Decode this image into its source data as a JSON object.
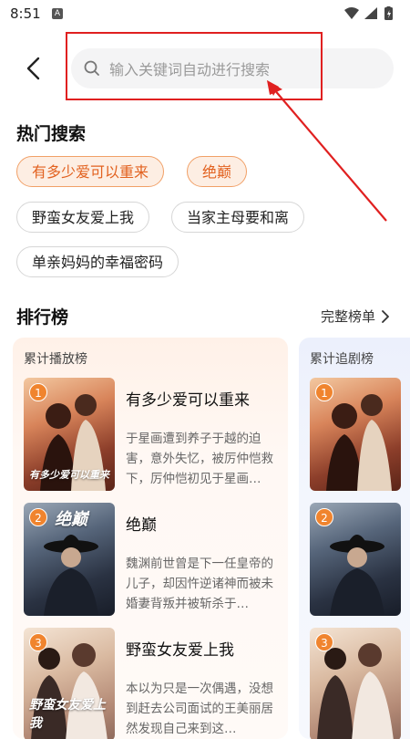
{
  "status_bar": {
    "time": "8:51",
    "badge": "A"
  },
  "search": {
    "placeholder": "输入关键词自动进行搜索"
  },
  "hot_search": {
    "title": "热门搜索",
    "tags": [
      {
        "label": "有多少爱可以重来",
        "hot": true
      },
      {
        "label": "绝巅",
        "hot": true
      },
      {
        "label": "野蛮女友爱上我",
        "hot": false
      },
      {
        "label": "当家主母要和离",
        "hot": false
      },
      {
        "label": "单亲妈妈的幸福密码",
        "hot": false
      }
    ]
  },
  "ranking": {
    "title": "排行榜",
    "full_list_label": "完整榜单",
    "panels": [
      {
        "title": "累计播放榜",
        "items": [
          {
            "rank": "1",
            "title": "有多少爱可以重来",
            "desc": "于星画遭到养子于越的迫害，意外失忆，被厉仲恺救下，厉仲恺初见于星画…",
            "poster_text": "有多少爱可以重来"
          },
          {
            "rank": "2",
            "title": "绝巅",
            "desc": "魏渊前世曾是下一任皇帝的儿子，却因忤逆诸神而被未婚妻背叛并被斩杀于…",
            "poster_text": "绝巅"
          },
          {
            "rank": "3",
            "title": "野蛮女友爱上我",
            "desc": "本以为只是一次偶遇，没想到赶去公司面试的王美丽居然发现自己来到这…",
            "poster_text": "野蛮女友爱上我"
          }
        ]
      },
      {
        "title": "累计追剧榜",
        "items": [
          {
            "rank": "1"
          },
          {
            "rank": "2"
          },
          {
            "rank": "3"
          }
        ]
      }
    ]
  },
  "colors": {
    "accent": "#e2611f",
    "hot_bg": "#fdeee3",
    "annotation": "#e02020",
    "badge": "#f0842e"
  }
}
